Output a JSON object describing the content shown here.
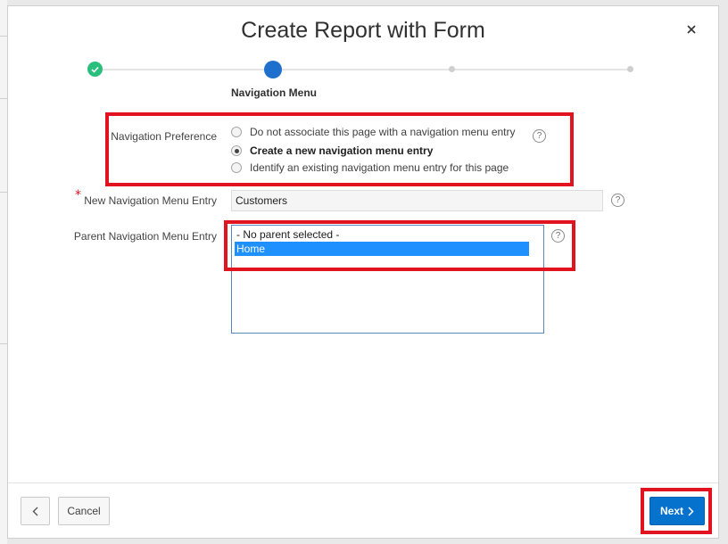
{
  "dialog": {
    "title": "Create Report with Form",
    "close_icon": "close-icon"
  },
  "wizard": {
    "current_step_label": "Navigation Menu",
    "completed_step_icon": "check-icon"
  },
  "form": {
    "navigation_preference": {
      "label": "Navigation Preference",
      "options": [
        {
          "label": "Do not associate this page with a navigation menu entry",
          "checked": false
        },
        {
          "label": "Create a new navigation menu entry",
          "checked": true
        },
        {
          "label": "Identify an existing navigation menu entry for this page",
          "checked": false
        }
      ],
      "help_icon": "help-icon"
    },
    "new_entry": {
      "required_marker": "*",
      "label": "New Navigation Menu Entry",
      "value": "Customers",
      "help_icon": "help-icon"
    },
    "parent_entry": {
      "label": "Parent Navigation Menu Entry",
      "options": [
        {
          "label": "- No parent selected -",
          "selected": false
        },
        {
          "label": "Home",
          "selected": true
        }
      ],
      "help_icon": "help-icon"
    }
  },
  "footer": {
    "back_icon": "chevron-left-icon",
    "cancel_label": "Cancel",
    "next_label": "Next",
    "next_icon": "chevron-right-icon"
  },
  "colors": {
    "accent": "#0572ce",
    "highlight": "#e1131f",
    "step_done": "#2bbf7e",
    "step_current": "#1f6fcc",
    "list_selected": "#1e90ff"
  }
}
